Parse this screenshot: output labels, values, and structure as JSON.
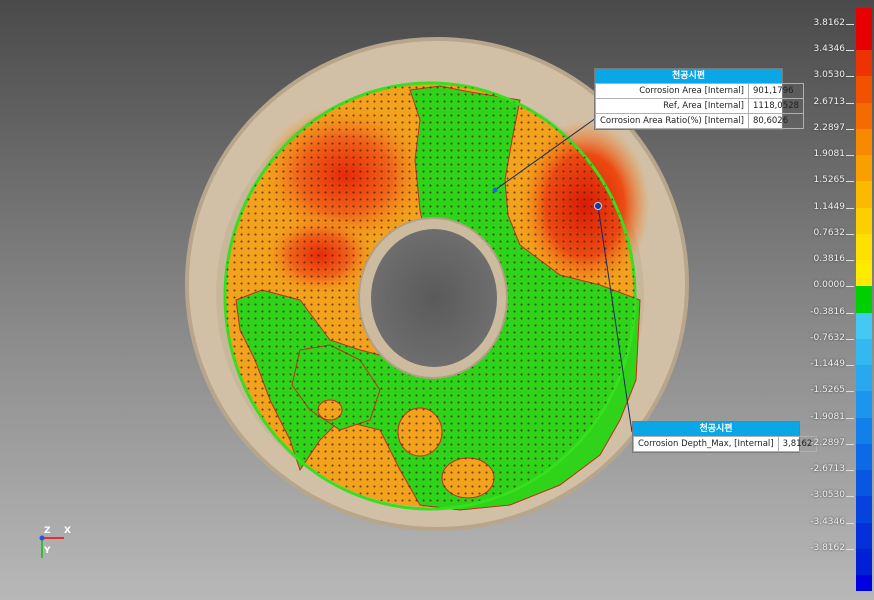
{
  "colorbar": {
    "labels": [
      "3.8162",
      "3.4346",
      "3.0530",
      "2.6713",
      "2.2897",
      "1.9081",
      "1.5265",
      "1.1449",
      "0.7632",
      "0.3816",
      "0.0000",
      "-0.3816",
      "-0.7632",
      "-1.1449",
      "-1.5265",
      "-1.9081",
      "-2.2897",
      "-2.6713",
      "-3.0530",
      "-3.4346",
      "-3.8162"
    ],
    "colors": [
      "#e60000",
      "#ee3300",
      "#f25200",
      "#f46c00",
      "#f88a00",
      "#f9a000",
      "#fbb900",
      "#fbcf00",
      "#ffe000",
      "#ffea00",
      "#00d000",
      "#44c8f4",
      "#34b8f0",
      "#28a8ee",
      "#1c96ec",
      "#1280ea",
      "#0c6ae6",
      "#0856e2",
      "#0642de",
      "#0430da",
      "#0020d6"
    ],
    "over_color": "#e60000",
    "under_color": "#0000e0"
  },
  "panel_area": {
    "title": "천공시편",
    "rows": [
      {
        "label": "Corrosion Area [Internal]",
        "value": "901,1796"
      },
      {
        "label": "Ref, Area [Internal]",
        "value": "1118,0528"
      },
      {
        "label": "Corrosion Area Ratio(%) [Internal]",
        "value": "80,6026"
      }
    ]
  },
  "panel_depth": {
    "title": "천공시편",
    "rows": [
      {
        "label": "Corrosion Depth_Max, [Internal]",
        "value": "3,8162"
      }
    ]
  },
  "axes": {
    "z": "Z",
    "x": "X",
    "y": "Y"
  }
}
